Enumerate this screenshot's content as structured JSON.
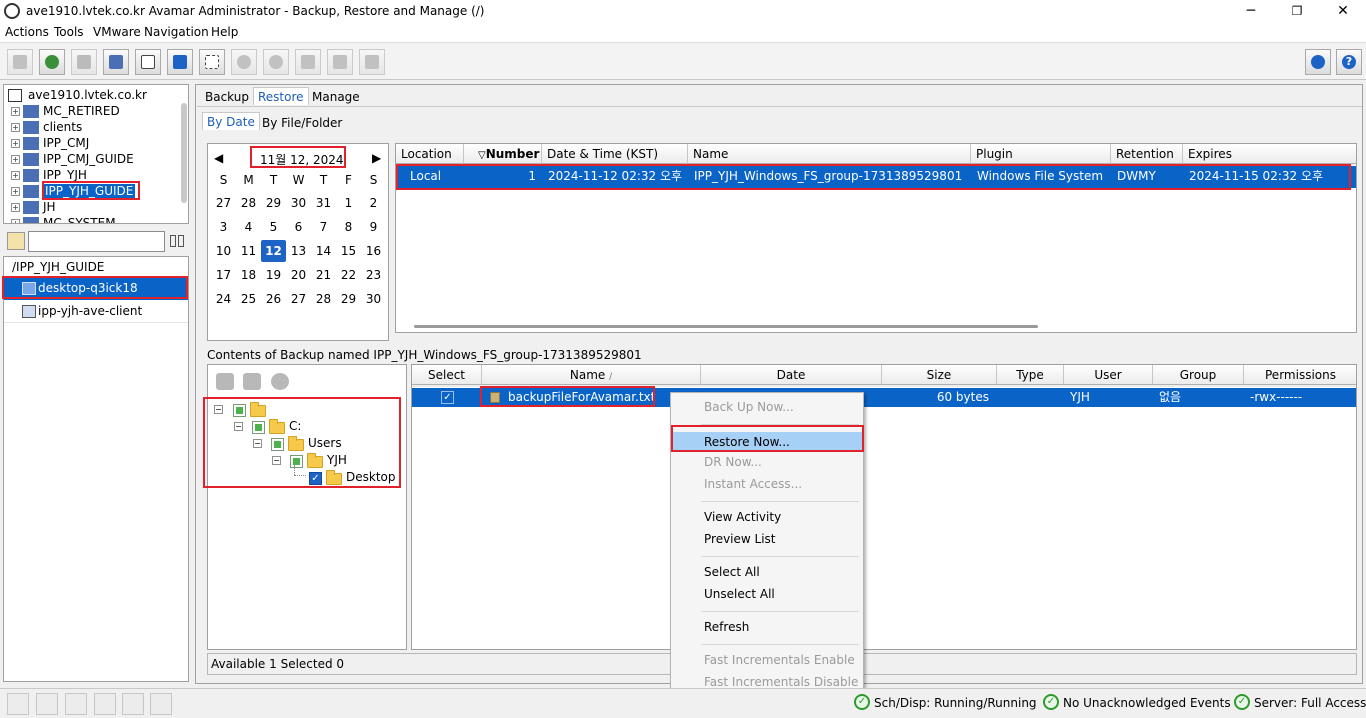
{
  "window": {
    "title": "ave1910.lvtek.co.kr Avamar Administrator - Backup, Restore and Manage (/)",
    "minimize": "─",
    "maximize": "❐",
    "close": "✕"
  },
  "menu": [
    "Actions",
    "Tools",
    "VMware",
    "Navigation",
    "Help"
  ],
  "domain_tree": [
    {
      "label": "ave1910.lvtek.co.kr",
      "root": true
    },
    {
      "label": "MC_RETIRED"
    },
    {
      "label": "clients"
    },
    {
      "label": "IPP_CMJ"
    },
    {
      "label": "IPP_CMJ_GUIDE"
    },
    {
      "label": "IPP_YJH"
    },
    {
      "label": "IPP_YJH_GUIDE",
      "selected": true
    },
    {
      "label": "JH"
    },
    {
      "label": "MC_SYSTEM"
    }
  ],
  "client_filter": {
    "placeholder": ""
  },
  "client_list": {
    "path": "/IPP_YJH_GUIDE",
    "items": [
      {
        "label": "desktop-q3ick18",
        "selected": true
      },
      {
        "label": "ipp-yjh-ave-client",
        "selected": false
      }
    ]
  },
  "main_tabs": [
    "Backup",
    "Restore",
    "Manage"
  ],
  "active_main_tab": "Restore",
  "sub_tabs": [
    "By Date",
    "By File/Folder"
  ],
  "calendar": {
    "month_label": "11월 12, 2024",
    "prev": "◀",
    "next": "▶",
    "weekdays": [
      "S",
      "M",
      "T",
      "W",
      "T",
      "F",
      "S"
    ],
    "weeks": [
      [
        "27",
        "28",
        "29",
        "30",
        "31",
        "1",
        "2"
      ],
      [
        "3",
        "4",
        "5",
        "6",
        "7",
        "8",
        "9"
      ],
      [
        "10",
        "11",
        "12",
        "13",
        "14",
        "15",
        "16"
      ],
      [
        "17",
        "18",
        "19",
        "20",
        "21",
        "22",
        "23"
      ],
      [
        "24",
        "25",
        "26",
        "27",
        "28",
        "29",
        "30"
      ]
    ],
    "selected_day": "12"
  },
  "backups_table": {
    "columns": [
      "Location",
      "Number",
      "Date & Time (KST)",
      "Name",
      "Plugin",
      "Retention",
      "Expires"
    ],
    "sort_indicator": "▽",
    "rows": [
      [
        "Local",
        "1",
        "2024-11-12 02:32 오후",
        "IPP_YJH_Windows_FS_group-1731389529801",
        "Windows File System",
        "DWMY",
        "2024-11-15 02:32 오후"
      ]
    ]
  },
  "contents": {
    "title": "Contents of Backup named IPP_YJH_Windows_FS_group-1731389529801",
    "tree": [
      {
        "label": ""
      },
      {
        "label": "C:"
      },
      {
        "label": "Users"
      },
      {
        "label": "YJH"
      },
      {
        "label": "Desktop"
      }
    ],
    "files_columns": [
      "Select",
      "Name",
      "Date",
      "Size",
      "Type",
      "User",
      "Group",
      "Permissions"
    ],
    "name_sort": "∕",
    "files_rows": [
      [
        "✓",
        "backupFileForAvamar.txt",
        "",
        "60 bytes",
        "",
        "YJH",
        "없음",
        "-rwx------"
      ]
    ],
    "status": "Available 1 Selected 0"
  },
  "context_menu": [
    {
      "label": "Back Up Now...",
      "disabled": true
    },
    {
      "sep": true
    },
    {
      "label": "Restore Now...",
      "disabled": false,
      "highlight": true
    },
    {
      "label": "DR Now...",
      "disabled": true
    },
    {
      "label": "Instant Access...",
      "disabled": true
    },
    {
      "sep": true
    },
    {
      "label": "View Activity",
      "disabled": false
    },
    {
      "label": "Preview List",
      "disabled": false
    },
    {
      "sep": true
    },
    {
      "label": "Select All",
      "disabled": false
    },
    {
      "label": "Unselect All",
      "disabled": false
    },
    {
      "sep": true
    },
    {
      "label": "Refresh",
      "disabled": false
    },
    {
      "sep": true
    },
    {
      "label": "Fast Incrementals Enable",
      "disabled": true
    },
    {
      "label": "Fast Incrementals Disable",
      "disabled": true
    }
  ],
  "status_bar": {
    "sched": "Sch/Disp: Running/Running",
    "events": "No Unacknowledged Events",
    "server": "Server: Full Access",
    "ok_glyph": "✓"
  },
  "colors": {
    "selection": "#0a64c8",
    "highlight_box": "#e1212c",
    "menu_hover": "#a7d0f7"
  }
}
